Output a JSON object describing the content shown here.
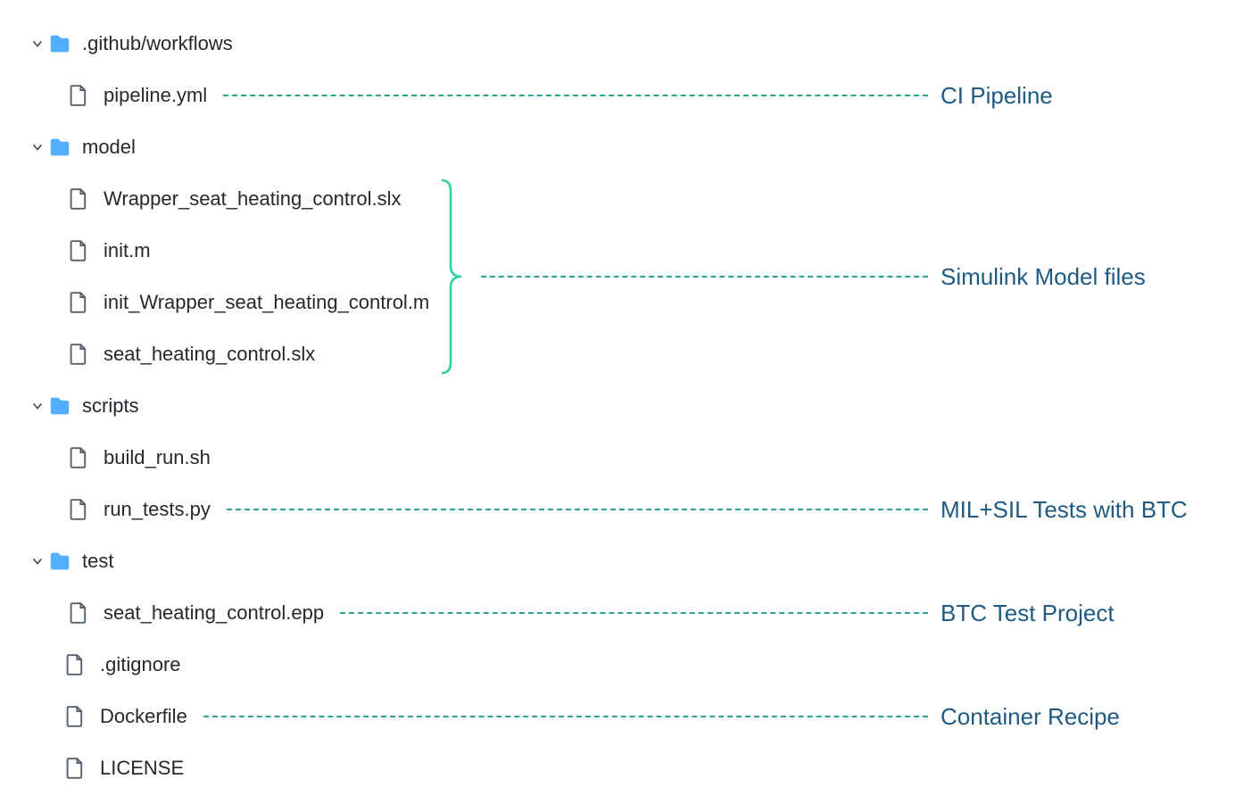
{
  "tree": {
    "github_workflows": ".github/workflows",
    "pipeline_yml": "pipeline.yml",
    "model": "model",
    "wrapper_slx": "Wrapper_seat_heating_control.slx",
    "init_m": "init.m",
    "init_wrapper_m": "init_Wrapper_seat_heating_control.m",
    "seat_slx": "seat_heating_control.slx",
    "scripts": "scripts",
    "build_run_sh": "build_run.sh",
    "run_tests_py": "run_tests.py",
    "test": "test",
    "seat_epp": "seat_heating_control.epp",
    "gitignore": ".gitignore",
    "dockerfile": "Dockerfile",
    "license": "LICENSE"
  },
  "annotations": {
    "ci_pipeline": "CI Pipeline",
    "simulink_model": "Simulink Model files",
    "mil_sil_tests": "MIL+SIL Tests with BTC",
    "btc_test_project": "BTC Test Project",
    "container_recipe": "Container Recipe"
  }
}
